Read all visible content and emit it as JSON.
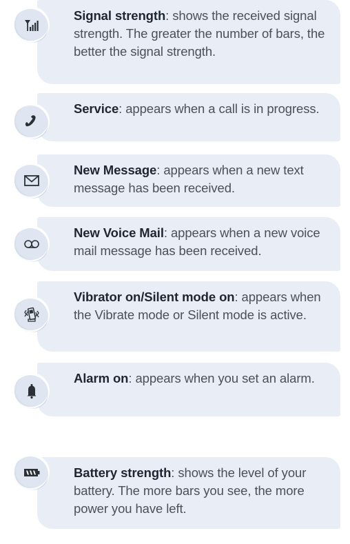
{
  "items": [
    {
      "icon": "signal-strength-icon",
      "term": "Signal strength",
      "desc": ": shows the received signal strength. The greater the number of bars, the better the signal strength."
    },
    {
      "icon": "phone-handset-icon",
      "term": "Service",
      "desc": ": appears when a call is in progress."
    },
    {
      "icon": "envelope-icon",
      "term": "New Message",
      "desc": ": appears when a new text message has been received."
    },
    {
      "icon": "voicemail-icon",
      "term": "New Voice Mail",
      "desc": ": appears when a new voice mail message has been received."
    },
    {
      "icon": "vibrate-phone-icon",
      "term": "Vibrator on/Silent mode on",
      "desc": ": appears when the Vibrate mode or Silent mode is active."
    },
    {
      "icon": "bell-icon",
      "term": "Alarm on",
      "desc": ": appears when you set an alarm."
    },
    {
      "icon": "battery-icon",
      "term": "Battery strength",
      "desc": ": shows the level of your battery. The more bars you see, the more power you have left."
    }
  ]
}
